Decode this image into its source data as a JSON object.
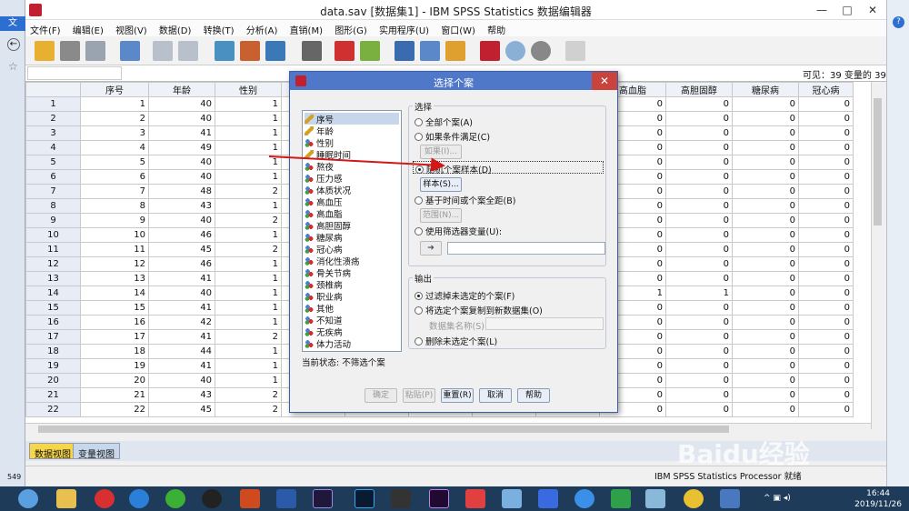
{
  "window": {
    "title": "data.sav [数据集1] - IBM SPSS Statistics 数据编辑器"
  },
  "menu": [
    "文件(F)",
    "编辑(E)",
    "视图(V)",
    "数据(D)",
    "转换(T)",
    "分析(A)",
    "直销(M)",
    "图形(G)",
    "实用程序(U)",
    "窗口(W)",
    "帮助"
  ],
  "visible_text": "可见：39 变量的 39",
  "grid": {
    "left_headers": [
      "序号",
      "年龄",
      "性别"
    ],
    "right_headers": [
      "高血脂",
      "高胆固醇",
      "糖尿病",
      "冠心病"
    ],
    "rows": [
      {
        "n": "1",
        "xh": "1",
        "nl": "40",
        "xb": "1",
        "r": [
          "0",
          "0",
          "0",
          "0"
        ]
      },
      {
        "n": "2",
        "xh": "2",
        "nl": "40",
        "xb": "1",
        "r": [
          "0",
          "0",
          "0",
          "0"
        ]
      },
      {
        "n": "3",
        "xh": "3",
        "nl": "41",
        "xb": "1",
        "r": [
          "0",
          "0",
          "0",
          "0"
        ]
      },
      {
        "n": "4",
        "xh": "4",
        "nl": "49",
        "xb": "1",
        "r": [
          "0",
          "0",
          "0",
          "0"
        ]
      },
      {
        "n": "5",
        "xh": "5",
        "nl": "40",
        "xb": "1",
        "r": [
          "0",
          "0",
          "0",
          "0"
        ]
      },
      {
        "n": "6",
        "xh": "6",
        "nl": "40",
        "xb": "1",
        "r": [
          "0",
          "0",
          "0",
          "0"
        ]
      },
      {
        "n": "7",
        "xh": "7",
        "nl": "48",
        "xb": "2",
        "r": [
          "0",
          "0",
          "0",
          "0"
        ]
      },
      {
        "n": "8",
        "xh": "8",
        "nl": "43",
        "xb": "1",
        "r": [
          "0",
          "0",
          "0",
          "0"
        ]
      },
      {
        "n": "9",
        "xh": "9",
        "nl": "40",
        "xb": "2",
        "r": [
          "0",
          "0",
          "0",
          "0"
        ]
      },
      {
        "n": "10",
        "xh": "10",
        "nl": "46",
        "xb": "1",
        "r": [
          "0",
          "0",
          "0",
          "0"
        ]
      },
      {
        "n": "11",
        "xh": "11",
        "nl": "45",
        "xb": "2",
        "r": [
          "0",
          "0",
          "0",
          "0"
        ]
      },
      {
        "n": "12",
        "xh": "12",
        "nl": "46",
        "xb": "1",
        "r": [
          "0",
          "0",
          "0",
          "0"
        ]
      },
      {
        "n": "13",
        "xh": "13",
        "nl": "41",
        "xb": "1",
        "r": [
          "0",
          "0",
          "0",
          "0"
        ]
      },
      {
        "n": "14",
        "xh": "14",
        "nl": "40",
        "xb": "1",
        "r": [
          "1",
          "1",
          "0",
          "0"
        ]
      },
      {
        "n": "15",
        "xh": "15",
        "nl": "41",
        "xb": "1",
        "r": [
          "0",
          "0",
          "0",
          "0"
        ]
      },
      {
        "n": "16",
        "xh": "16",
        "nl": "42",
        "xb": "1",
        "r": [
          "0",
          "0",
          "0",
          "0"
        ]
      },
      {
        "n": "17",
        "xh": "17",
        "nl": "41",
        "xb": "2",
        "r": [
          "0",
          "0",
          "0",
          "0"
        ]
      },
      {
        "n": "18",
        "xh": "18",
        "nl": "44",
        "xb": "1",
        "r": [
          "0",
          "0",
          "0",
          "0"
        ]
      },
      {
        "n": "19",
        "xh": "19",
        "nl": "41",
        "xb": "1",
        "r": [
          "0",
          "0",
          "0",
          "0"
        ]
      },
      {
        "n": "20",
        "xh": "20",
        "nl": "40",
        "xb": "1",
        "r": [
          "0",
          "0",
          "0",
          "0"
        ]
      },
      {
        "n": "21",
        "xh": "21",
        "nl": "43",
        "xb": "2",
        "r": [
          "0",
          "0",
          "0",
          "0"
        ]
      },
      {
        "n": "22",
        "xh": "22",
        "nl": "45",
        "xb": "2",
        "r": [
          "0",
          "0",
          "0",
          "0"
        ]
      }
    ]
  },
  "tabs": {
    "data_view": "数据视图",
    "variable_view": "变量视图"
  },
  "status": "IBM SPSS Statistics Processor 就绪",
  "dialog": {
    "title": "选择个案",
    "variables": [
      "序号",
      "年龄",
      "性别",
      "睡眠时间",
      "熬夜",
      "压力感",
      "体质状况",
      "高血压",
      "高血脂",
      "高胆固醇",
      "糖尿病",
      "冠心病",
      "消化性溃疡",
      "骨关节病",
      "颈椎病",
      "职业病",
      "其他",
      "不知道",
      "无疾病",
      "体力活动"
    ],
    "select_group": "选择",
    "opt_all": "全部个案(A)",
    "opt_if": "如果条件满足(C)",
    "btn_if": "如果(I)...",
    "opt_random": "随机个案样本(D)",
    "btn_sample": "样本(S)...",
    "opt_range": "基于时间或个案全距(B)",
    "btn_range": "范围(N)...",
    "opt_filter": "使用筛选器变量(U):",
    "output_group": "输出",
    "out_filter": "过滤掉未选定的个案(F)",
    "out_copy": "将选定个案复制到新数据集(O)",
    "dataset_name_label": "数据集名称(S):",
    "out_delete": "删除未选定个案(L)",
    "current_status": "当前状态: 不筛选个案",
    "btn_ok": "确定",
    "btn_paste": "粘贴(P)",
    "btn_reset": "重置(R)",
    "btn_cancel": "取消",
    "btn_help": "帮助"
  },
  "watermark": "Baidu经验",
  "taskbar": {
    "time": "16:44",
    "date": "2019/11/26"
  },
  "left_edge_text": "文",
  "left_edge_number": "549"
}
